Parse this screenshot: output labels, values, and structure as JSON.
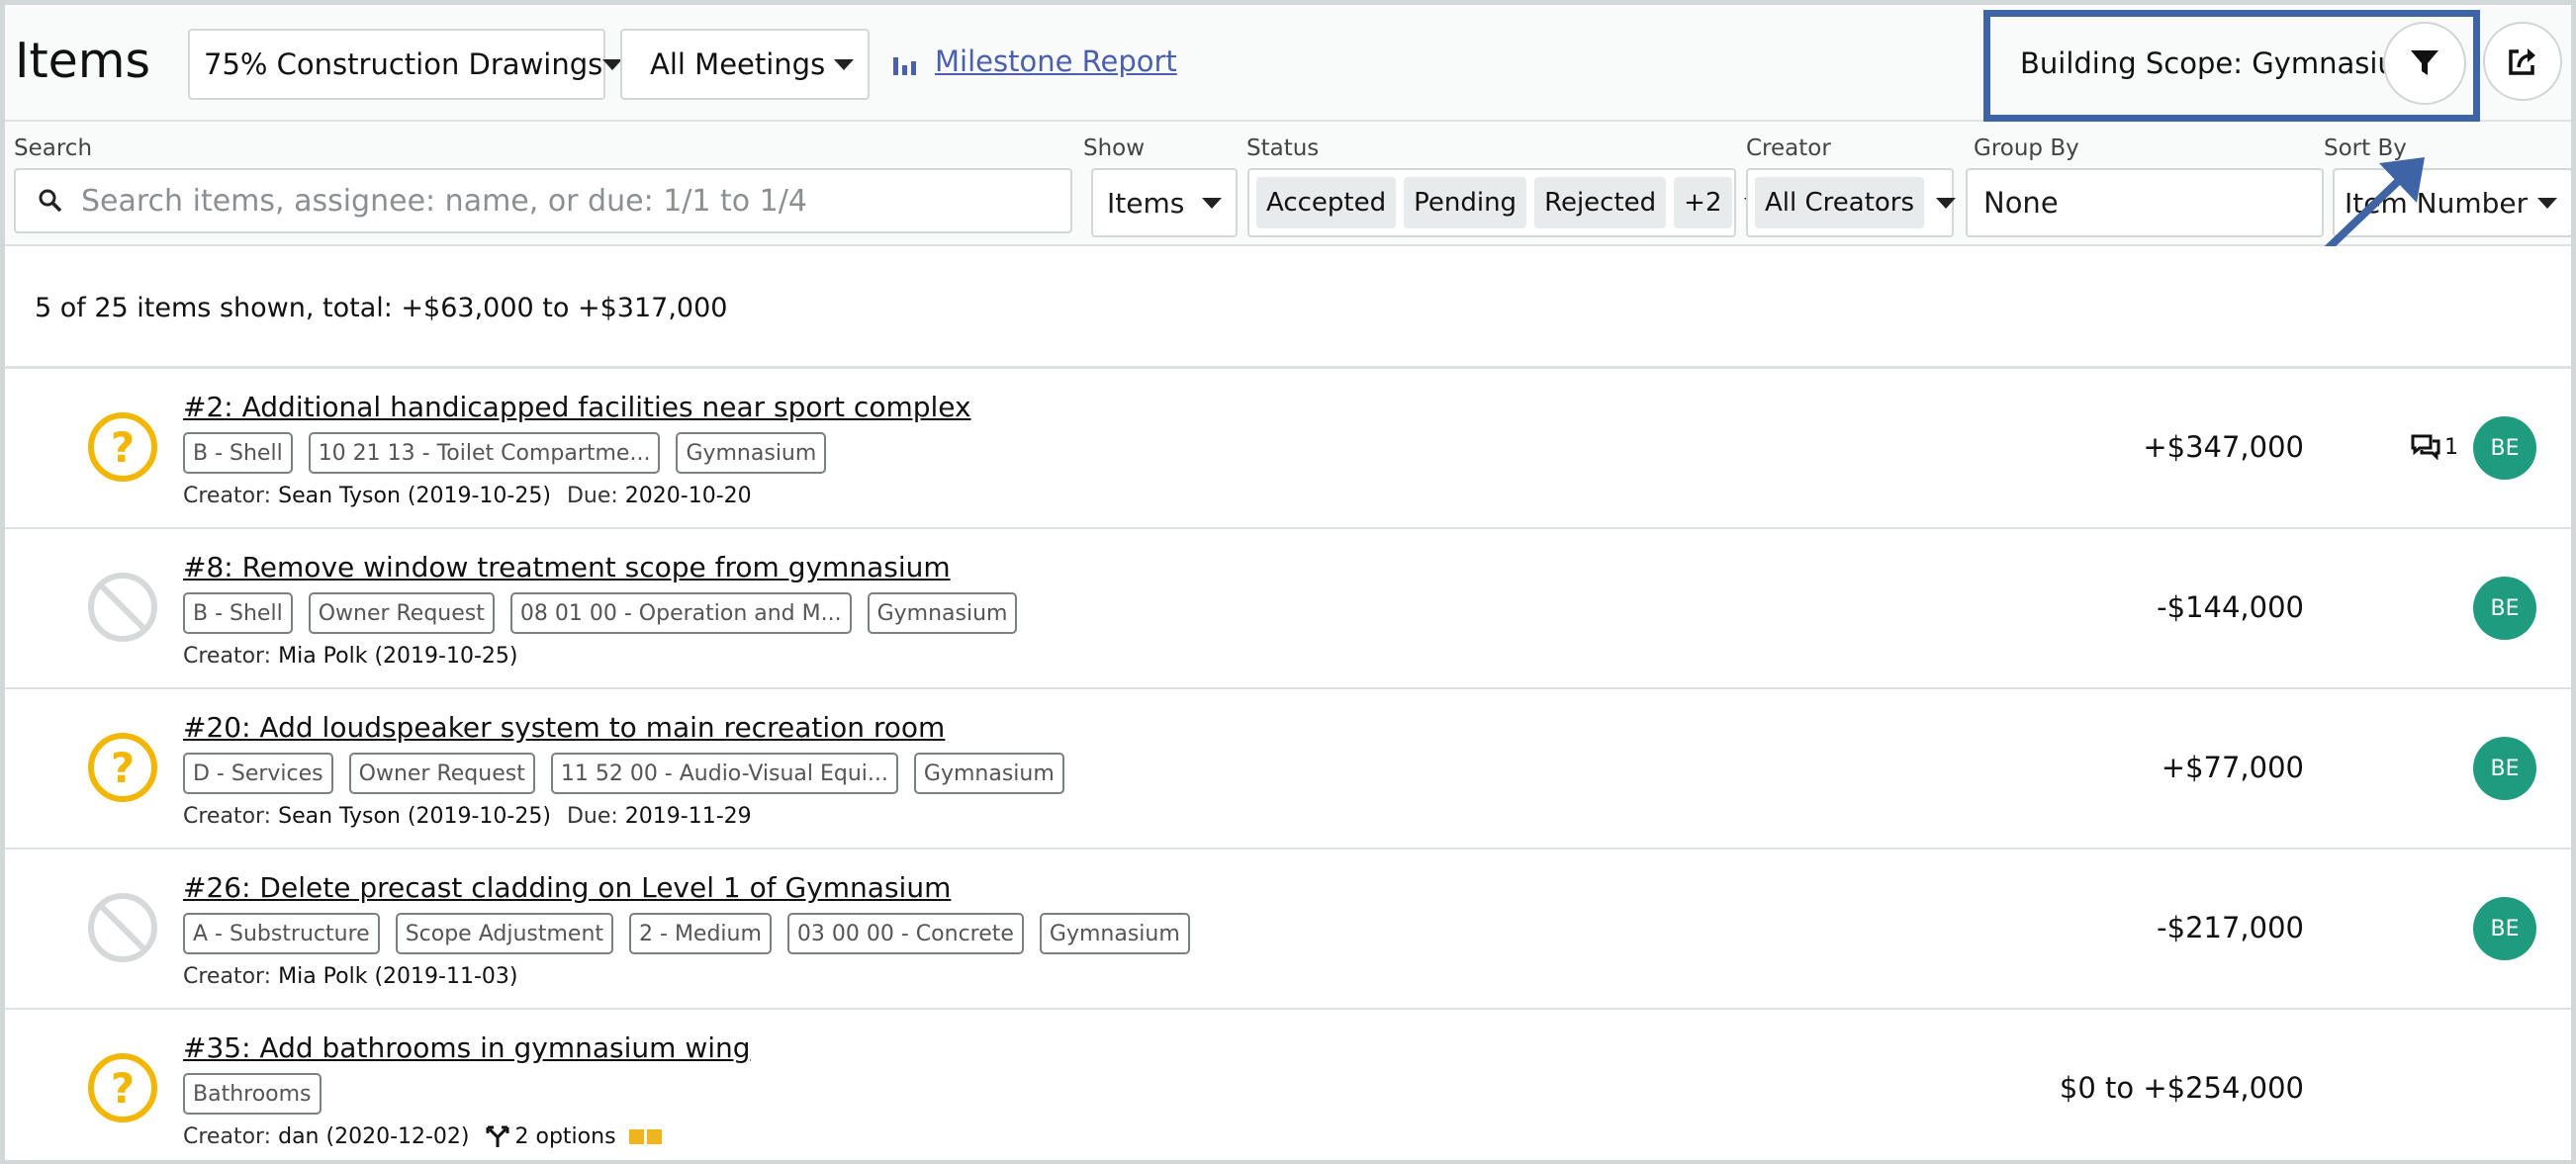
{
  "header": {
    "title": "Items",
    "milestone_select": "75% Construction Drawings",
    "meetings_select": "All Meetings",
    "milestone_report_link": "Milestone Report",
    "building_scope": "Building Scope: Gymnasium",
    "filter_icon": "filter-funnel-icon",
    "export_icon": "share-export-icon",
    "highlight_color": "#3f64a6"
  },
  "filters": {
    "search_label": "Search",
    "search_placeholder": "Search items, assignee: name, or due: 1/1 to 1/4",
    "show_label": "Show",
    "show_value": "Items",
    "status_label": "Status",
    "status_chips": [
      "Accepted",
      "Pending",
      "Rejected",
      "+2"
    ],
    "creator_label": "Creator",
    "creator_value": "All Creators",
    "group_by_label": "Group By",
    "group_by_value": "None",
    "sort_by_label": "Sort By",
    "sort_by_value": "Item Number"
  },
  "summary": "5 of 25 items shown, total: +$63,000 to +$317,000",
  "items": [
    {
      "status": "pending",
      "status_icon": "question-circle-icon",
      "title": "#2: Additional handicapped facilities near sport complex",
      "tags": [
        "B - Shell",
        "10 21 13 - Toilet Compartme...",
        "Gymnasium"
      ],
      "creator_label": "Creator:",
      "creator": "Sean Tyson (2019-10-25)",
      "due_label": "Due:",
      "due": "2020-10-20",
      "amount": "+$347,000",
      "comment_count": "1",
      "avatar": "BE"
    },
    {
      "status": "rejected",
      "status_icon": "prohibited-circle-icon",
      "title": "#8: Remove window treatment scope from gymnasium",
      "tags": [
        "B - Shell",
        "Owner Request",
        "08 01 00 - Operation and M...",
        "Gymnasium"
      ],
      "creator_label": "Creator:",
      "creator": "Mia Polk (2019-10-25)",
      "amount": "-$144,000",
      "avatar": "BE"
    },
    {
      "status": "pending",
      "status_icon": "question-circle-icon",
      "title": "#20: Add loudspeaker system to main recreation room",
      "tags": [
        "D - Services",
        "Owner Request",
        "11 52 00 - Audio-Visual Equi...",
        "Gymnasium"
      ],
      "creator_label": "Creator:",
      "creator": "Sean Tyson (2019-10-25)",
      "due_label": "Due:",
      "due": "2019-11-29",
      "amount": "+$77,000",
      "avatar": "BE"
    },
    {
      "status": "rejected",
      "status_icon": "prohibited-circle-icon",
      "title": "#26: Delete precast cladding on Level 1 of Gymnasium",
      "tags": [
        "A - Substructure",
        "Scope Adjustment",
        "2 - Medium",
        "03 00 00 - Concrete",
        "Gymnasium"
      ],
      "creator_label": "Creator:",
      "creator": "Mia Polk (2019-11-03)",
      "amount": "-$217,000",
      "avatar": "BE"
    },
    {
      "status": "pending",
      "status_icon": "question-circle-icon",
      "title": "#35: Add bathrooms in gymnasium wing",
      "tags": [
        "Bathrooms"
      ],
      "creator_label": "Creator:",
      "creator": "dan (2020-12-02)",
      "options": "2 options",
      "amount": "$0 to +$254,000"
    }
  ],
  "colors": {
    "pending": "#f2b705",
    "rejected": "#d6d9da",
    "avatar": "#1f9c7f",
    "link": "#4a5fb0"
  }
}
